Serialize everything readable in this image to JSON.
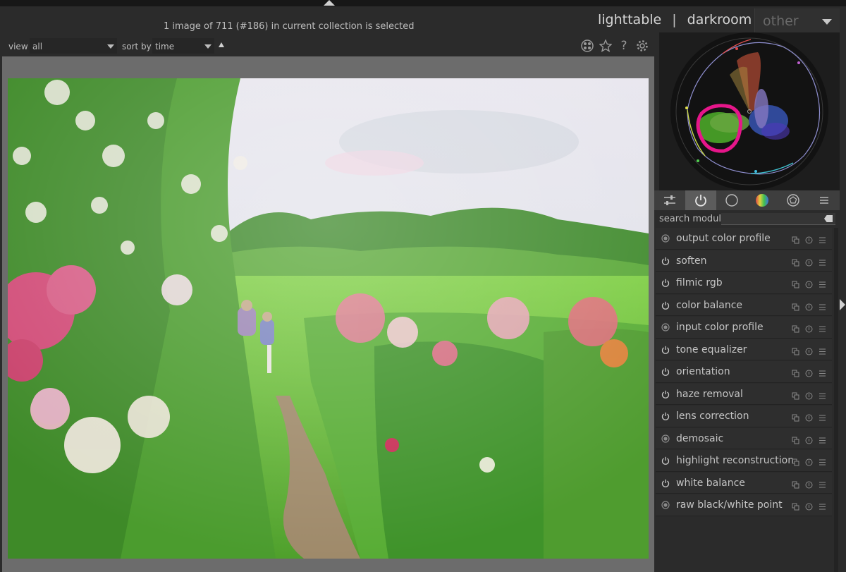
{
  "header": {
    "status_text": "1 image of 711 (#186) in current collection is selected",
    "views": [
      "lighttable",
      "darkroom"
    ],
    "view_separator": "|",
    "other_label": "other"
  },
  "filterbar": {
    "view_label": "view",
    "view_value": "all",
    "sort_label": "sort by",
    "sort_value": "time"
  },
  "toolbar_icons": [
    "color-labels-icon",
    "star-icon",
    "help-icon",
    "gear-icon"
  ],
  "panel": {
    "tabs": [
      "quick-access-icon",
      "power-icon",
      "circle-icon",
      "color-wheel-icon",
      "aperture-icon",
      "hamburger-icon"
    ],
    "active_tab": 1,
    "search_label": "search module",
    "search_value": ""
  },
  "modules": [
    {
      "label": "output color profile",
      "always_on": true
    },
    {
      "label": "soften",
      "always_on": false
    },
    {
      "label": "filmic rgb",
      "always_on": false
    },
    {
      "label": "color balance",
      "always_on": false
    },
    {
      "label": "input color profile",
      "always_on": true
    },
    {
      "label": "tone equalizer",
      "always_on": false
    },
    {
      "label": "orientation",
      "always_on": false
    },
    {
      "label": "haze removal",
      "always_on": false
    },
    {
      "label": "lens correction",
      "always_on": false
    },
    {
      "label": "demosaic",
      "always_on": true
    },
    {
      "label": "highlight reconstruction",
      "always_on": false
    },
    {
      "label": "white balance",
      "always_on": false
    },
    {
      "label": "raw black/white point",
      "always_on": true
    }
  ],
  "colors": {
    "background": "#2b2b2b",
    "center_bg": "#6c6c6c",
    "text": "#bdbdbd",
    "annotation": "#e6168a"
  }
}
